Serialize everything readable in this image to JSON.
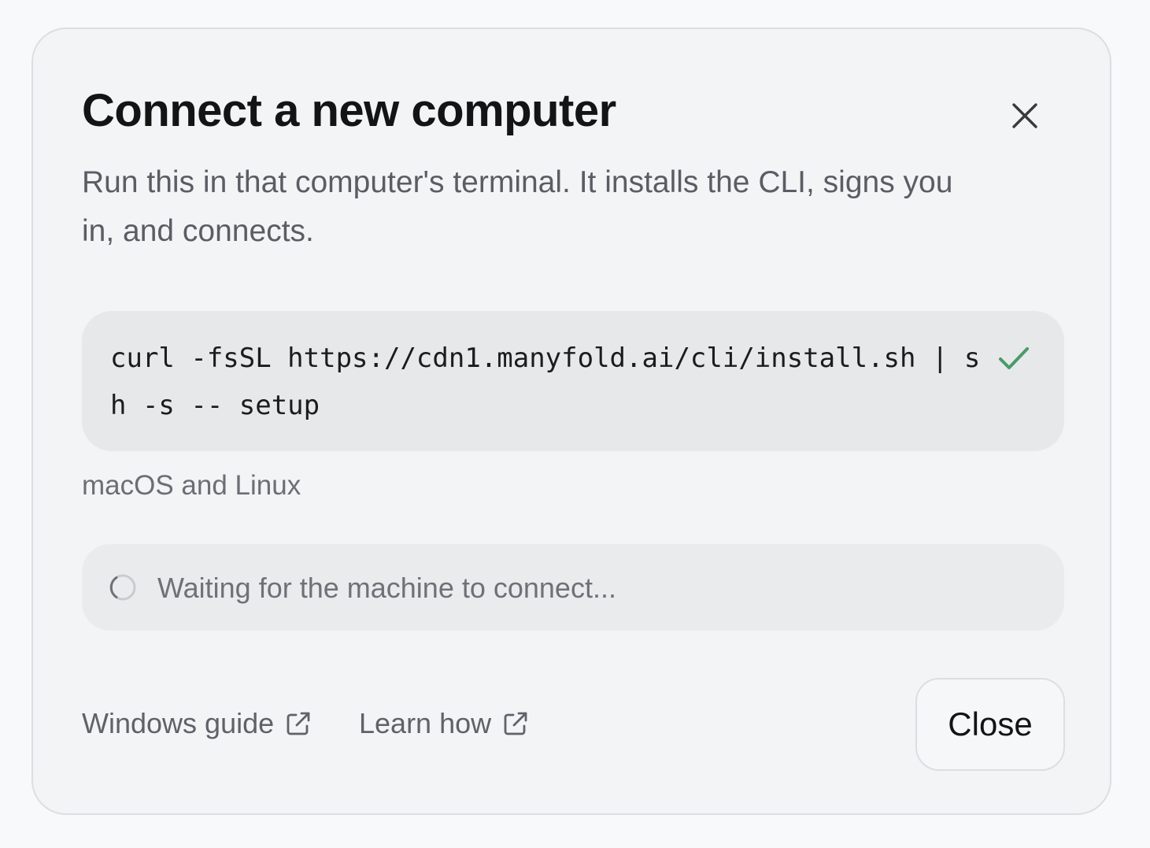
{
  "dialog": {
    "title": "Connect a new computer",
    "subtitle": "Run this in that computer's terminal. It installs the CLI, signs you in, and connects.",
    "close_icon": "close-icon"
  },
  "command": {
    "text": "curl -fsSL https://cdn1.manyfold.ai/cli/install.sh | sh -s -- setup",
    "status_icon": "checkmark-icon",
    "status_color": "#4a9a6a"
  },
  "platform_note": "macOS and Linux",
  "connection": {
    "status_text": "Waiting for the machine to connect...",
    "icon": "spinner-icon"
  },
  "footer": {
    "windows_guide": "Windows guide",
    "learn_how": "Learn how",
    "link_icon": "external-link-icon",
    "close_label": "Close"
  }
}
